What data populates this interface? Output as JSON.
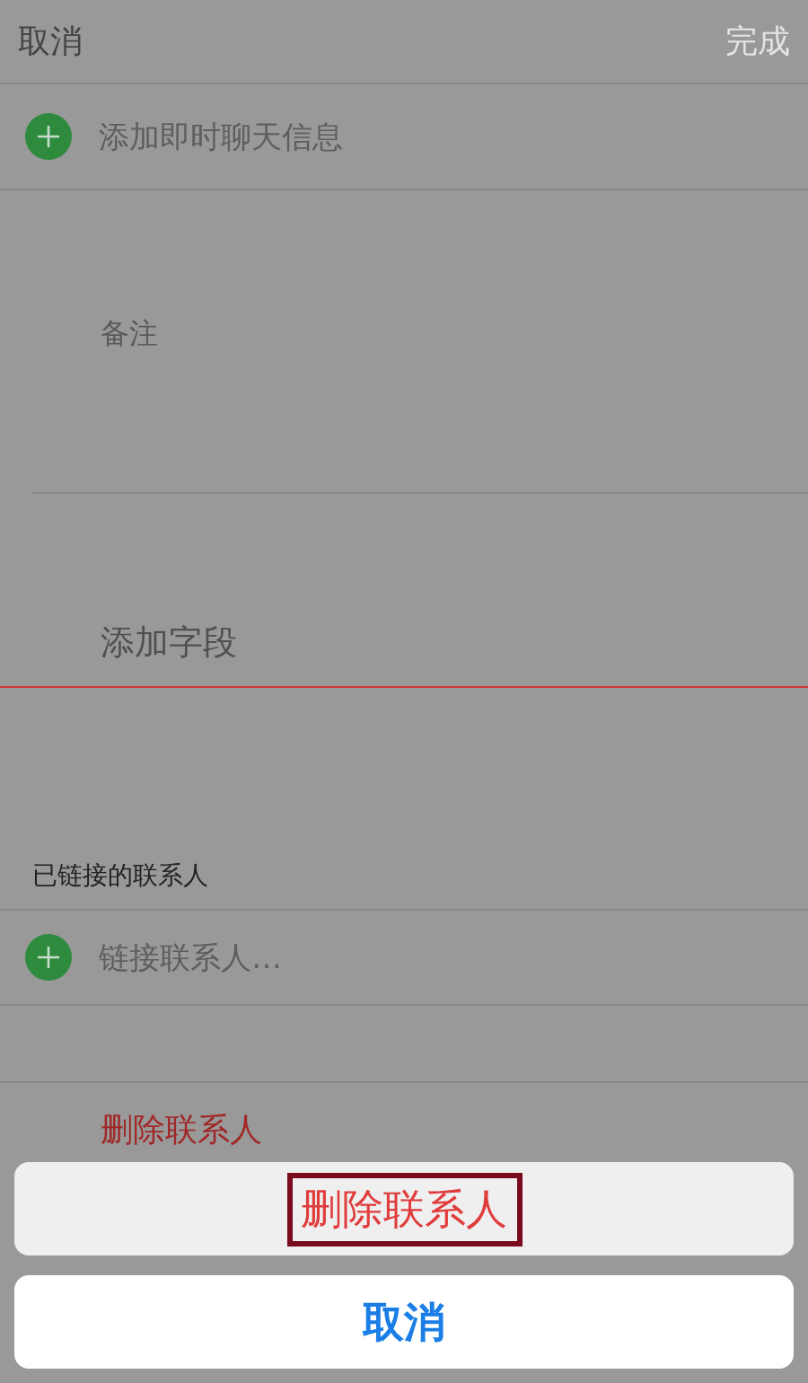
{
  "nav": {
    "cancel": "取消",
    "done": "完成",
    "done_disabled": true
  },
  "rows": [
    {
      "kind": "add",
      "label": "添加即时聊天信息"
    },
    {
      "kind": "notes",
      "placeholder": "备注"
    },
    {
      "kind": "field",
      "label": "添加字段"
    }
  ],
  "linked_section": {
    "header": "已链接的联系人",
    "add_label": "链接联系人…"
  },
  "delete_label": "删除联系人",
  "action_sheet": {
    "destructive": {
      "label": "删除联系人",
      "highlighted": true
    },
    "cancel": "取消"
  }
}
